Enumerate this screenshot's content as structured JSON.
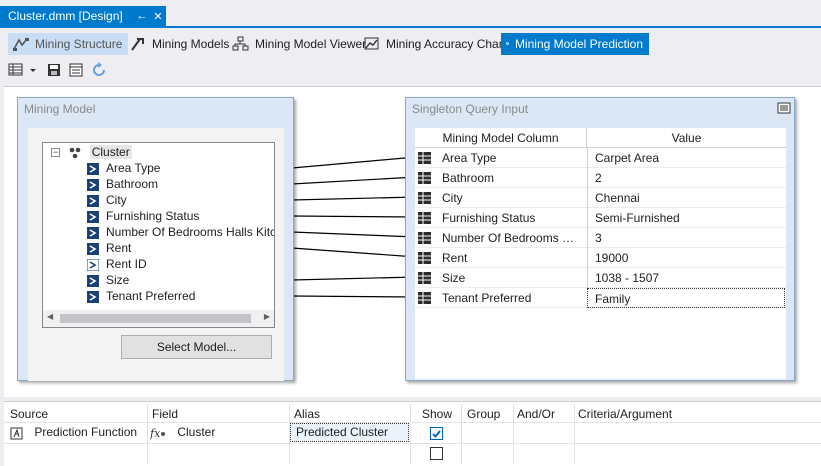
{
  "document_tab": {
    "title": "Cluster.dmm [Design]",
    "pin_icon": "pin-icon",
    "close_icon": "close-icon"
  },
  "designer_tabs": [
    {
      "label": "Mining Structure",
      "icon": "mining-structure-icon"
    },
    {
      "label": "Mining Models",
      "icon": "mining-models-icon"
    },
    {
      "label": "Mining Model Viewer",
      "icon": "model-viewer-icon"
    },
    {
      "label": "Mining Accuracy Chart",
      "icon": "accuracy-chart-icon"
    },
    {
      "label": "Mining Model Prediction",
      "icon": "prediction-icon"
    }
  ],
  "toolbar": [
    "result-view-icon",
    "dropdown-icon",
    "save-icon",
    "query-view-icon",
    "refresh-icon"
  ],
  "mining_model": {
    "title": "Mining Model",
    "root": "Cluster",
    "columns": [
      "Area Type",
      "Bathroom",
      "City",
      "Furnishing Status",
      "Number Of Bedrooms Halls Kitchens",
      "Rent",
      "Rent ID",
      "Size",
      "Tenant Preferred"
    ],
    "select_button": "Select Model..."
  },
  "singleton_query": {
    "title": "Singleton Query Input",
    "headers": {
      "column": "Mining Model Column",
      "value": "Value"
    },
    "rows": [
      {
        "column": "Area Type",
        "value": "Carpet Area"
      },
      {
        "column": "Bathroom",
        "value": "2"
      },
      {
        "column": "City",
        "value": "Chennai"
      },
      {
        "column": "Furnishing Status",
        "value": "Semi-Furnished"
      },
      {
        "column": "Number Of Bedrooms Hall...",
        "value": "3"
      },
      {
        "column": "Rent",
        "value": "19000"
      },
      {
        "column": "Size",
        "value": "1038 - 1507"
      },
      {
        "column": "Tenant Preferred",
        "value": "Family"
      }
    ]
  },
  "prediction_grid": {
    "headers": {
      "source": "Source",
      "field": "Field",
      "alias": "Alias",
      "show": "Show",
      "group": "Group",
      "andor": "And/Or",
      "criteria": "Criteria/Argument"
    },
    "rows": [
      {
        "source": "Prediction Function",
        "field": "Cluster",
        "alias": "Predicted Cluster",
        "show": true
      },
      {
        "source": "",
        "field": "",
        "alias": "",
        "show": false
      }
    ]
  },
  "colors": {
    "accent": "#007acc",
    "panel_bg": "#dbe7f5",
    "selected_tab": "#c9def5"
  }
}
